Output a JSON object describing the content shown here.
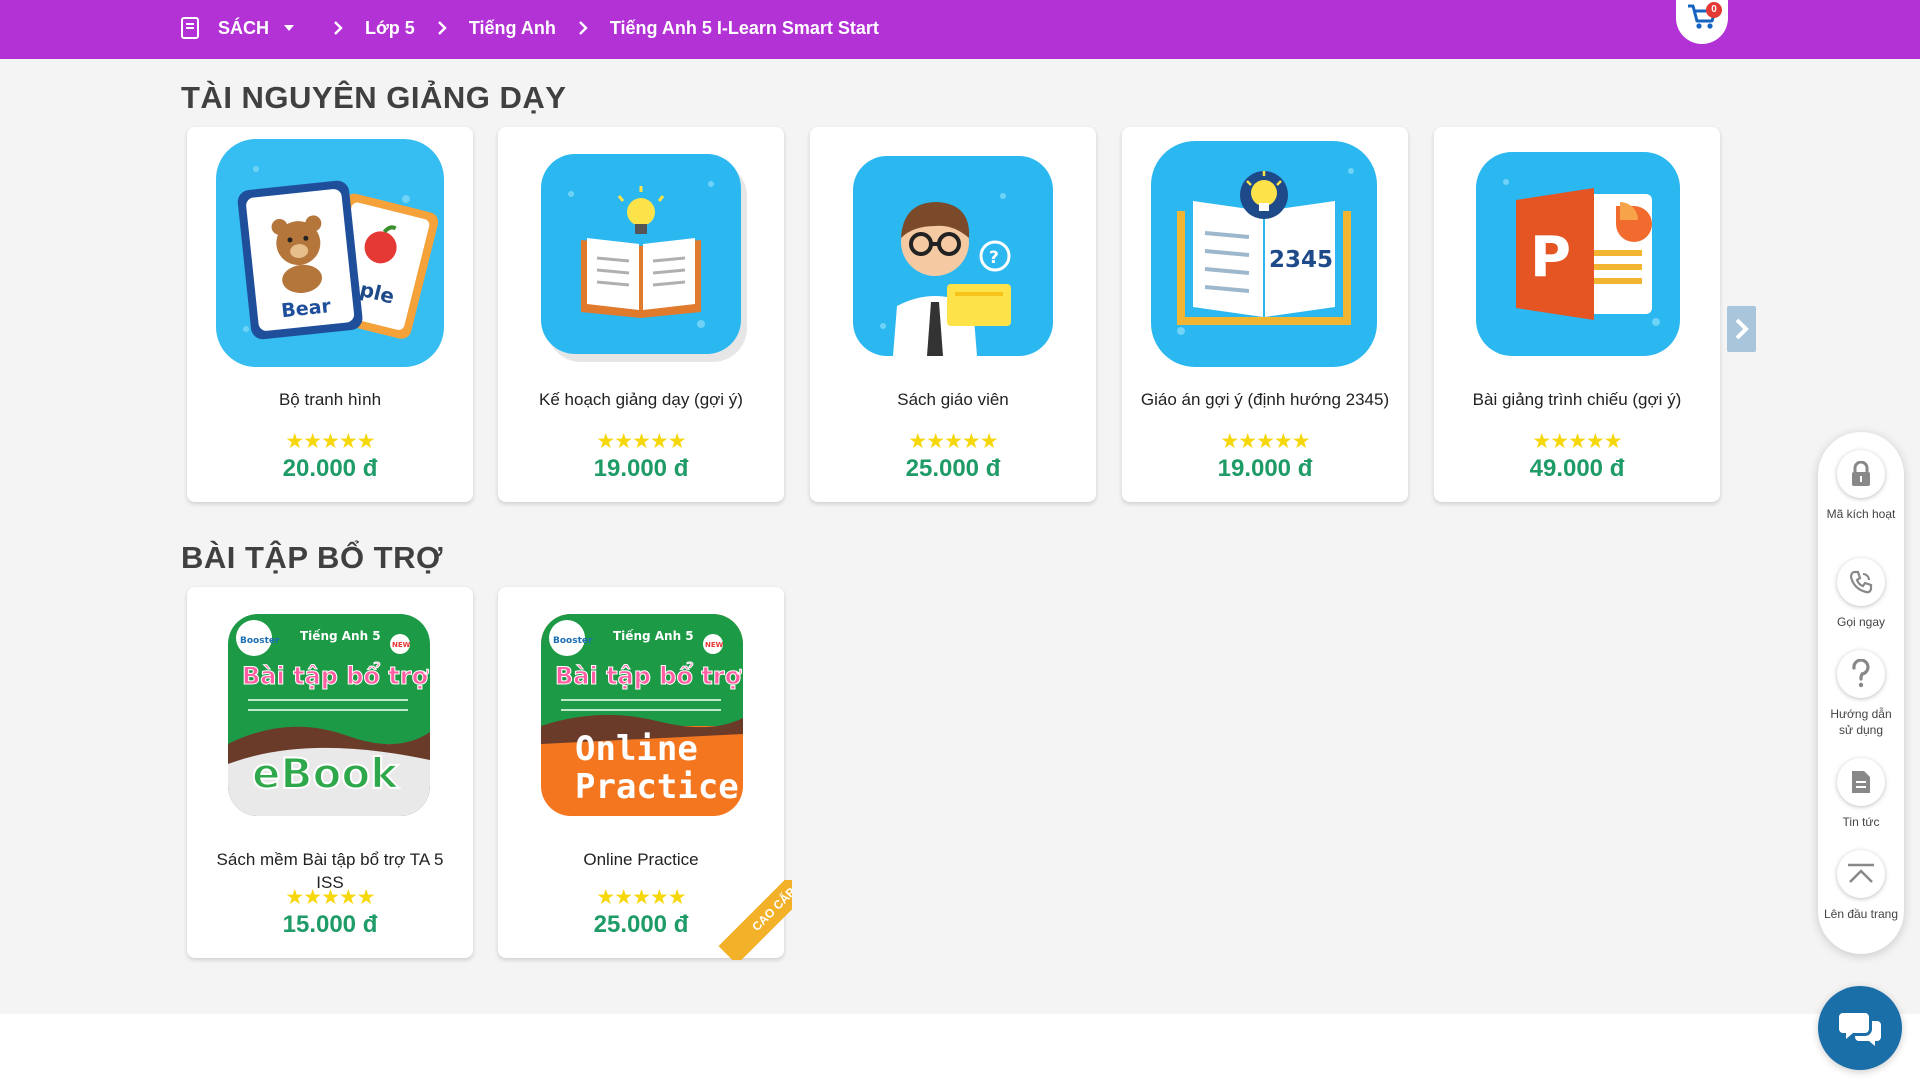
{
  "header": {
    "breadcrumb": [
      "SÁCH",
      "Lớp 5",
      "Tiếng Anh",
      "Tiếng Anh 5 I-Learn Smart Start"
    ],
    "cart_count": "0",
    "colors": {
      "bar": "#b232d6"
    }
  },
  "sections": {
    "teaching": {
      "title": "TÀI NGUYÊN GIẢNG DẠY",
      "items": [
        {
          "name": "Bộ tranh hình",
          "rating": 5,
          "price": "20.000 đ",
          "icon": "flashcards-icon",
          "card_words": [
            "Bear",
            "pple"
          ]
        },
        {
          "name": "Kế hoạch giảng dạy (gợi ý)",
          "rating": 5,
          "price": "19.000 đ",
          "icon": "open-book-bulb-icon"
        },
        {
          "name": "Sách giáo viên",
          "rating": 5,
          "price": "25.000 đ",
          "icon": "teacher-icon",
          "badge_glyph": "?"
        },
        {
          "name": "Giáo án gợi ý (định hướng 2345)",
          "rating": 5,
          "price": "19.000 đ",
          "icon": "lesson-plan-icon",
          "number": "2345"
        },
        {
          "name": "Bài giảng trình chiếu (gợi ý)",
          "rating": 5,
          "price": "49.000 đ",
          "icon": "powerpoint-icon",
          "letter": "P"
        }
      ]
    },
    "practice": {
      "title": "BÀI TẬP BỔ TRỢ",
      "items": [
        {
          "name": "Sách mềm Bài tập bổ trợ TA 5 ISS",
          "rating": 5,
          "price": "15.000 đ",
          "cover": {
            "brand": "Booster",
            "series": "Tiếng Anh 5",
            "tag": "NEW",
            "title": "Bài tập bổ trợ",
            "big": "eBook"
          }
        },
        {
          "name": "Online Practice",
          "rating": 5,
          "price": "25.000 đ",
          "premium_label": "CAO CẤP",
          "cover": {
            "brand": "Booster",
            "series": "Tiếng Anh 5",
            "tag": "NEW",
            "title": "Bài tập bổ trợ",
            "big_lines": [
              "Online",
              "Practice"
            ]
          }
        }
      ]
    }
  },
  "sidebar": {
    "items": [
      {
        "label": "Mã kích hoạt",
        "icon": "lock-icon"
      },
      {
        "label": "Gọi ngay",
        "icon": "phone-icon"
      },
      {
        "label": "Hướng dẫn sử dụng",
        "icon": "question-icon"
      },
      {
        "label": "Tin tức",
        "icon": "document-icon"
      },
      {
        "label": "Lên đầu trang",
        "icon": "scroll-top-icon"
      }
    ]
  },
  "stars_glyph": "★★★★★",
  "colors": {
    "price": "#1f9b67",
    "stars": "#f6d70c",
    "thumb_blue": "#2fb8ef",
    "chat": "#1a6fa8"
  }
}
